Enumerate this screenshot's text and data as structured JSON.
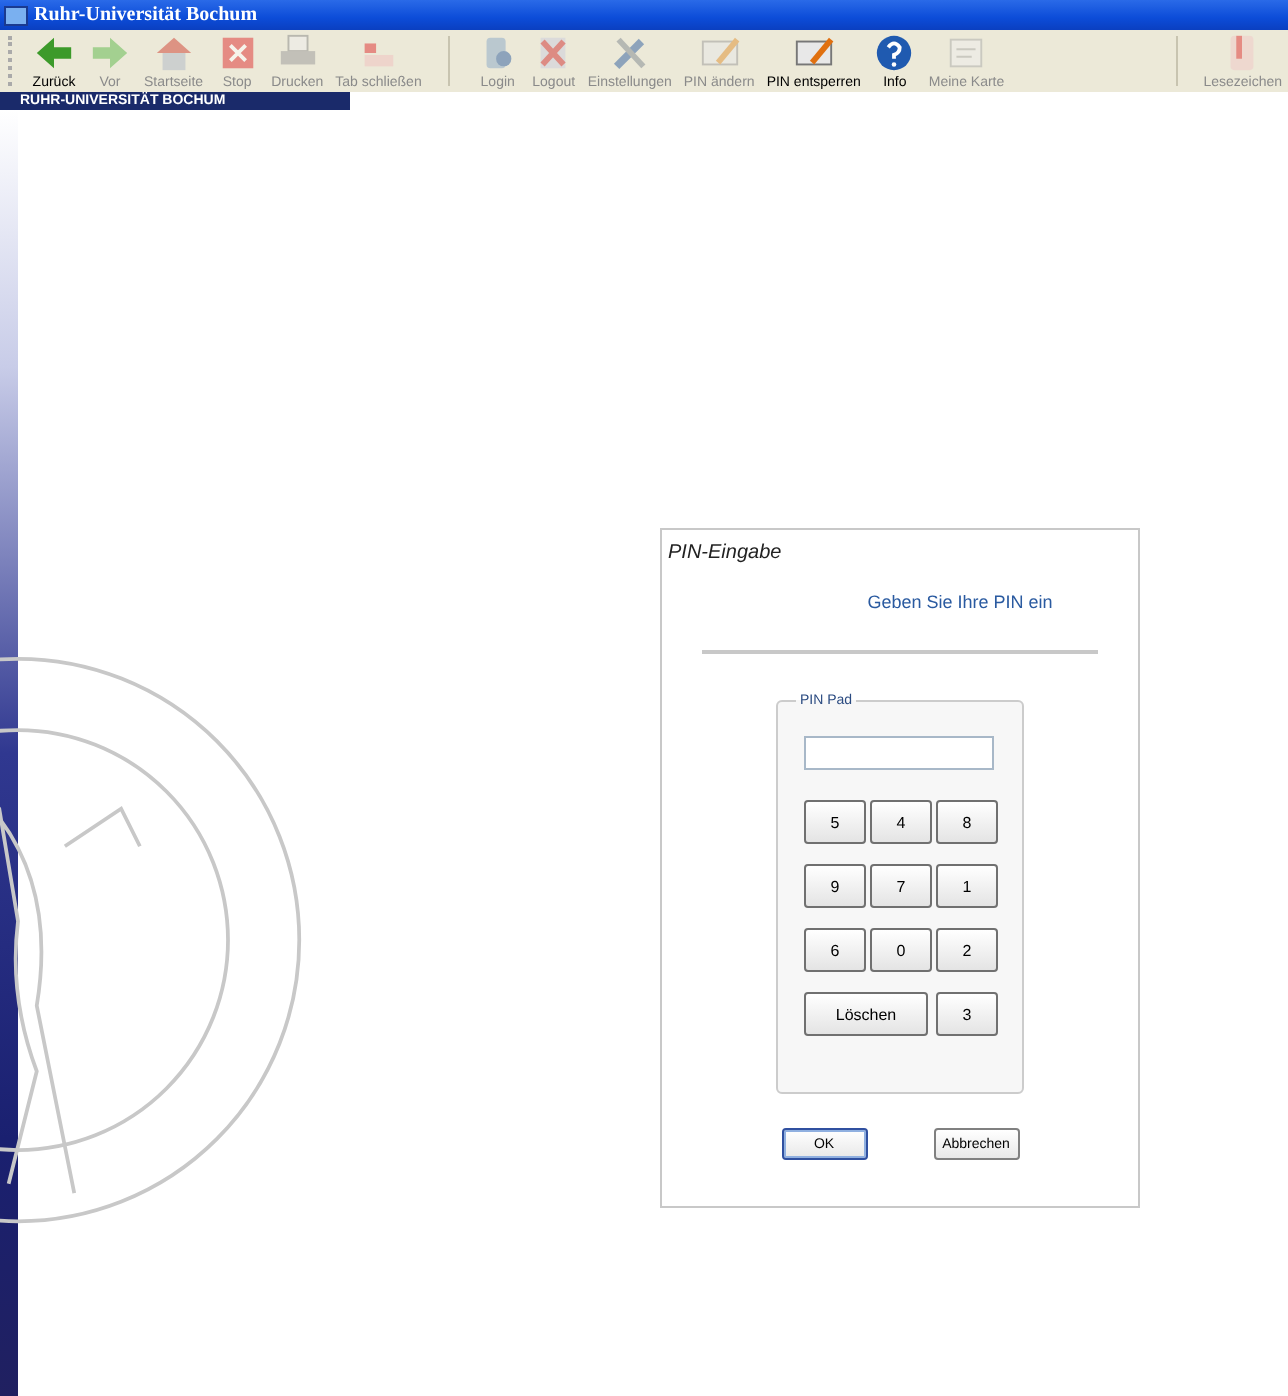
{
  "window": {
    "title": "Ruhr-Universität Bochum"
  },
  "toolbar": {
    "groups": [
      [
        {
          "label": "Zurück",
          "disabled": false
        },
        {
          "label": "Vor",
          "disabled": true
        },
        {
          "label": "Startseite",
          "disabled": true
        },
        {
          "label": "Stop",
          "disabled": true
        },
        {
          "label": "Drucken",
          "disabled": true
        },
        {
          "label": "Tab schließen",
          "disabled": true
        }
      ],
      [
        {
          "label": "Login",
          "disabled": true
        },
        {
          "label": "Logout",
          "disabled": true
        },
        {
          "label": "Einstellungen",
          "disabled": true
        },
        {
          "label": "PIN ändern",
          "disabled": true
        },
        {
          "label": "PIN entsperren",
          "disabled": false
        },
        {
          "label": "Info",
          "disabled": false
        },
        {
          "label": "Meine Karte",
          "disabled": true
        }
      ],
      [
        {
          "label": "Lesezeichen",
          "disabled": true
        }
      ]
    ]
  },
  "banner": {
    "text": "RUHR-UNIVERSITÄT BOCHUM"
  },
  "dialog": {
    "title": "PIN-Eingabe",
    "prompt": "Geben Sie Ihre PIN ein",
    "pin_pad": {
      "legend": "PIN Pad",
      "keys": [
        {
          "label": "5",
          "kind": "digit"
        },
        {
          "label": "4",
          "kind": "digit"
        },
        {
          "label": "8",
          "kind": "digit"
        },
        {
          "label": "9",
          "kind": "digit"
        },
        {
          "label": "7",
          "kind": "digit"
        },
        {
          "label": "1",
          "kind": "digit"
        },
        {
          "label": "6",
          "kind": "digit"
        },
        {
          "label": "0",
          "kind": "digit"
        },
        {
          "label": "2",
          "kind": "digit"
        },
        {
          "label": "Löschen",
          "kind": "wide"
        },
        {
          "label": "3",
          "kind": "digit"
        }
      ]
    },
    "buttons": [
      {
        "label": "OK",
        "default": true
      },
      {
        "label": "Abbrechen",
        "default": false
      }
    ]
  }
}
